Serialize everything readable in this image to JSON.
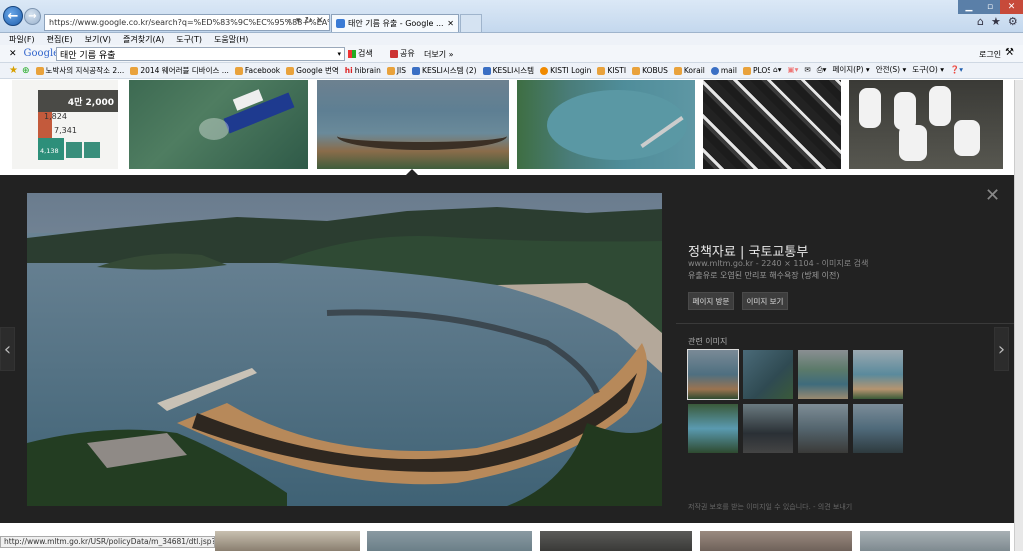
{
  "browser": {
    "address": "https://www.google.co.kr/search?q=%ED%83%9C%EC%95%88+%EA%B8",
    "tab_title": "태안 기름 유출 - Google ...",
    "menu": [
      "파일(F)",
      "편집(E)",
      "보기(V)",
      "즐겨찾기(A)",
      "도구(T)",
      "도움말(H)"
    ],
    "google_toolbar": {
      "logo": "Google",
      "query": "태안 기름 유출",
      "search_label": "검색",
      "share_label": "공유",
      "more_label": "더보기 »",
      "login_label": "로그인"
    },
    "favorites": [
      "노박사의 지식공작소 2...",
      "2014 웨어러블 디바이스 ...",
      "Facebook",
      "Google 번역",
      "hibrain",
      "JIS",
      "KESLI시스템 (2)",
      "KESLI시스템",
      "KISTI Login",
      "KISTI",
      "KOBUS",
      "Korail",
      "mail",
      "PLOS"
    ],
    "command_bar": [
      "페이지(P) ▾",
      "안전(S) ▾",
      "도구(O) ▾"
    ],
    "status_url": "http://www.mltm.go.kr/USR/policyData/m_34681/dtl.jsp?id=252"
  },
  "infographic": {
    "v1": "4만 2,000",
    "v2": "1,824",
    "v3": "7,341",
    "v4": "4,138"
  },
  "preview": {
    "title": "정책자료 | 국토교통부",
    "meta": "www.mltm.go.kr - 2240 × 1104 - 이미지로 검색",
    "description": "유출유로 오염된 만리포 해수욕장 (방제 이전)",
    "visit_button": "페이지 방문",
    "view_button": "이미지 보기",
    "related_label": "관련 이미지",
    "footer": "저작권 보호를 받는 이미지일 수 있습니다.  -  의견 보내기"
  },
  "colors": {
    "panel": "#222222",
    "accent": "#1f5fae"
  }
}
